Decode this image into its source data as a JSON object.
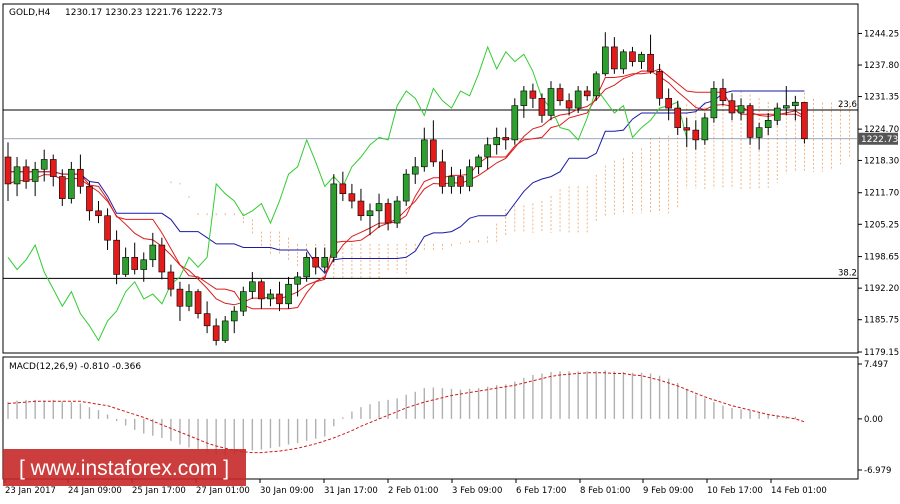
{
  "chart_data": [
    {
      "type": "candlestick",
      "symbol_label": "GOLD,H4",
      "ohlc_label": "1230.17 1230.23 1221.76 1222.73",
      "ylim": [
        1179.15,
        1247.0
      ],
      "y_ticks": [
        "1244.25",
        "1237.80",
        "1231.35",
        "1224.70",
        "1218.30",
        "1211.70",
        "1205.25",
        "1198.65",
        "1192.20",
        "1185.75",
        "1179.15"
      ],
      "x_labels": [
        "23 Jan 2017",
        "24 Jan 09:00",
        "25 Jan 17:00",
        "27 Jan 01:00",
        "30 Jan 09:00",
        "31 Jan 17:00",
        "2 Feb 01:00",
        "3 Feb 09:00",
        "6 Feb 17:00",
        "8 Feb 01:00",
        "9 Feb 09:00",
        "10 Feb 17:00",
        "14 Feb 01:00"
      ],
      "current_price": "1222.73",
      "level_lines": [
        {
          "label": "23.6",
          "value": 1228.6
        },
        {
          "label": "38.2",
          "value": 1194.2
        }
      ],
      "colors": {
        "bull": "#2e9e2e",
        "bear": "#e31b1b",
        "tenkan": "#e31b1b",
        "kijun": "#1a1aa8",
        "chikou": "#33cc33",
        "cloud": "#f0a060",
        "ma": "#d42020"
      },
      "candles": [
        [
          1219.0,
          1222.0,
          1210.0,
          1213.5
        ],
        [
          1213.5,
          1219.0,
          1211.0,
          1217.0
        ],
        [
          1217.0,
          1218.5,
          1212.5,
          1214.0
        ],
        [
          1214.0,
          1218.0,
          1211.0,
          1216.5
        ],
        [
          1216.5,
          1220.5,
          1214.0,
          1218.5
        ],
        [
          1218.5,
          1219.5,
          1213.0,
          1215.0
        ],
        [
          1215.0,
          1216.5,
          1209.0,
          1210.5
        ],
        [
          1210.5,
          1218.0,
          1209.5,
          1216.5
        ],
        [
          1216.5,
          1219.5,
          1211.5,
          1213.0
        ],
        [
          1213.0,
          1214.0,
          1206.0,
          1208.0
        ],
        [
          1208.0,
          1210.0,
          1205.5,
          1207.0
        ],
        [
          1207.0,
          1208.5,
          1200.0,
          1202.0
        ],
        [
          1202.0,
          1204.0,
          1193.0,
          1195.0
        ],
        [
          1195.0,
          1200.5,
          1194.5,
          1198.5
        ],
        [
          1198.5,
          1201.5,
          1195.0,
          1196.0
        ],
        [
          1196.0,
          1199.5,
          1193.5,
          1198.0
        ],
        [
          1198.0,
          1203.5,
          1196.5,
          1201.0
        ],
        [
          1201.0,
          1202.5,
          1194.0,
          1195.5
        ],
        [
          1195.5,
          1197.0,
          1190.5,
          1192.0
        ],
        [
          1192.0,
          1193.5,
          1185.5,
          1188.5
        ],
        [
          1188.5,
          1193.0,
          1187.5,
          1191.5
        ],
        [
          1191.5,
          1192.0,
          1186.0,
          1187.0
        ],
        [
          1187.0,
          1189.5,
          1183.0,
          1184.5
        ],
        [
          1184.5,
          1186.0,
          1180.5,
          1181.5
        ],
        [
          1181.5,
          1186.5,
          1181.0,
          1185.5
        ],
        [
          1185.5,
          1188.5,
          1183.0,
          1187.5
        ],
        [
          1187.5,
          1192.5,
          1186.5,
          1191.5
        ],
        [
          1191.5,
          1195.5,
          1190.0,
          1193.5
        ],
        [
          1193.5,
          1194.0,
          1188.0,
          1190.0
        ],
        [
          1190.0,
          1192.0,
          1188.5,
          1191.0
        ],
        [
          1191.0,
          1193.5,
          1187.5,
          1189.0
        ],
        [
          1189.0,
          1194.5,
          1188.0,
          1193.0
        ],
        [
          1193.0,
          1195.5,
          1190.5,
          1194.5
        ],
        [
          1194.5,
          1199.5,
          1193.5,
          1198.5
        ],
        [
          1198.5,
          1200.5,
          1195.0,
          1196.5
        ],
        [
          1196.5,
          1200.5,
          1195.5,
          1198.5
        ],
        [
          1198.5,
          1215.5,
          1197.5,
          1213.5
        ],
        [
          1213.5,
          1216.0,
          1210.0,
          1211.5
        ],
        [
          1211.5,
          1213.5,
          1208.5,
          1210.0
        ],
        [
          1210.0,
          1212.5,
          1206.0,
          1207.0
        ],
        [
          1207.0,
          1209.5,
          1203.0,
          1208.0
        ],
        [
          1208.0,
          1211.5,
          1204.5,
          1209.5
        ],
        [
          1209.5,
          1210.5,
          1204.0,
          1205.5
        ],
        [
          1205.5,
          1211.0,
          1204.5,
          1210.0
        ],
        [
          1210.0,
          1216.5,
          1209.0,
          1215.5
        ],
        [
          1215.5,
          1219.0,
          1213.5,
          1217.0
        ],
        [
          1217.0,
          1225.0,
          1216.0,
          1222.5
        ],
        [
          1222.5,
          1226.5,
          1217.0,
          1218.0
        ],
        [
          1218.0,
          1220.5,
          1211.5,
          1213.0
        ],
        [
          1213.0,
          1217.0,
          1211.5,
          1215.0
        ],
        [
          1215.0,
          1216.5,
          1211.5,
          1213.0
        ],
        [
          1213.0,
          1218.5,
          1212.0,
          1217.0
        ],
        [
          1217.0,
          1219.5,
          1215.5,
          1219.0
        ],
        [
          1219.0,
          1223.0,
          1216.5,
          1221.5
        ],
        [
          1221.5,
          1225.0,
          1219.5,
          1223.0
        ],
        [
          1223.0,
          1225.0,
          1220.5,
          1222.5
        ],
        [
          1222.5,
          1231.0,
          1221.5,
          1229.5
        ],
        [
          1229.5,
          1233.5,
          1227.0,
          1232.5
        ],
        [
          1232.5,
          1234.0,
          1229.0,
          1231.0
        ],
        [
          1231.0,
          1232.0,
          1226.0,
          1227.5
        ],
        [
          1227.5,
          1234.5,
          1226.5,
          1233.0
        ],
        [
          1233.0,
          1234.0,
          1229.5,
          1230.5
        ],
        [
          1230.5,
          1232.0,
          1227.5,
          1229.0
        ],
        [
          1229.0,
          1233.5,
          1228.0,
          1232.5
        ],
        [
          1232.5,
          1233.5,
          1230.5,
          1231.5
        ],
        [
          1231.5,
          1236.5,
          1230.5,
          1236.0
        ],
        [
          1236.0,
          1244.5,
          1235.5,
          1241.5
        ],
        [
          1241.5,
          1243.5,
          1236.0,
          1237.0
        ],
        [
          1237.0,
          1241.0,
          1236.0,
          1240.5
        ],
        [
          1240.5,
          1241.5,
          1237.5,
          1238.5
        ],
        [
          1238.5,
          1240.5,
          1237.0,
          1240.0
        ],
        [
          1240.0,
          1244.0,
          1236.0,
          1236.5
        ],
        [
          1236.5,
          1238.0,
          1229.5,
          1231.0
        ],
        [
          1231.0,
          1233.0,
          1226.5,
          1229.0
        ],
        [
          1229.0,
          1230.5,
          1223.5,
          1225.0
        ],
        [
          1225.0,
          1227.0,
          1221.0,
          1224.5
        ],
        [
          1224.5,
          1226.5,
          1220.5,
          1222.5
        ],
        [
          1222.5,
          1228.0,
          1221.5,
          1227.0
        ],
        [
          1227.0,
          1234.5,
          1226.0,
          1233.0
        ],
        [
          1233.0,
          1235.0,
          1229.5,
          1230.5
        ],
        [
          1230.5,
          1232.0,
          1226.5,
          1228.0
        ],
        [
          1228.0,
          1231.0,
          1226.5,
          1229.5
        ],
        [
          1229.5,
          1230.0,
          1221.5,
          1223.0
        ],
        [
          1223.0,
          1226.0,
          1220.5,
          1225.0
        ],
        [
          1225.0,
          1228.0,
          1223.5,
          1226.5
        ],
        [
          1226.5,
          1230.0,
          1225.5,
          1229.0
        ],
        [
          1229.0,
          1233.5,
          1227.5,
          1229.5
        ],
        [
          1229.5,
          1231.5,
          1226.5,
          1230.2
        ],
        [
          1230.17,
          1230.23,
          1221.76,
          1222.73
        ]
      ]
    },
    {
      "type": "histogram",
      "indicator_label": "MACD(12,26,9) -0.810 -0.366",
      "ylim": [
        -6.979,
        7.497
      ],
      "y_ticks": [
        "7.497",
        "0.00",
        "-6.979"
      ],
      "macd": [
        2.3,
        2.5,
        2.6,
        2.6,
        2.5,
        2.6,
        2.4,
        2.3,
        2.1,
        1.6,
        1.2,
        0.6,
        -0.3,
        -0.9,
        -1.5,
        -2.0,
        -2.3,
        -2.6,
        -3.0,
        -3.5,
        -3.9,
        -4.3,
        -4.6,
        -4.9,
        -5.0,
        -4.9,
        -4.6,
        -4.3,
        -4.2,
        -4.0,
        -3.8,
        -3.5,
        -3.3,
        -3.0,
        -2.7,
        -2.4,
        -1.0,
        0.2,
        1.0,
        1.6,
        2.0,
        2.4,
        2.6,
        2.8,
        3.3,
        3.7,
        4.2,
        4.3,
        4.2,
        4.1,
        4.0,
        4.1,
        4.2,
        4.4,
        4.6,
        4.7,
        5.1,
        5.6,
        6.0,
        6.2,
        6.4,
        6.5,
        6.5,
        6.5,
        6.5,
        6.5,
        6.6,
        6.5,
        6.4,
        6.3,
        6.3,
        6.2,
        5.9,
        5.5,
        4.9,
        4.1,
        3.3,
        2.8,
        2.3,
        1.8,
        1.5,
        1.3,
        1.1,
        0.9,
        0.6,
        0.5,
        0.4,
        0.3,
        0.0
      ],
      "signal": [
        2.1,
        2.2,
        2.3,
        2.4,
        2.4,
        2.4,
        2.4,
        2.4,
        2.4,
        2.2,
        2.0,
        1.8,
        1.4,
        1.0,
        0.6,
        0.2,
        -0.3,
        -0.8,
        -1.3,
        -1.8,
        -2.3,
        -2.8,
        -3.3,
        -3.7,
        -4.0,
        -4.3,
        -4.5,
        -4.6,
        -4.6,
        -4.5,
        -4.4,
        -4.2,
        -4.0,
        -3.7,
        -3.4,
        -3.0,
        -2.6,
        -2.1,
        -1.6,
        -1.0,
        -0.5,
        0.0,
        0.5,
        1.0,
        1.5,
        1.9,
        2.3,
        2.6,
        2.9,
        3.2,
        3.4,
        3.6,
        3.8,
        4.0,
        4.2,
        4.4,
        4.6,
        4.9,
        5.2,
        5.5,
        5.8,
        6.0,
        6.1,
        6.2,
        6.3,
        6.3,
        6.3,
        6.2,
        6.2,
        6.0,
        5.9,
        5.6,
        5.3,
        4.9,
        4.5,
        4.0,
        3.5,
        3.0,
        2.6,
        2.2,
        1.8,
        1.5,
        1.2,
        0.9,
        0.6,
        0.4,
        0.2,
        0.0,
        -0.4
      ]
    }
  ],
  "watermark": {
    "text": "[ www.instaforex.com ]"
  }
}
